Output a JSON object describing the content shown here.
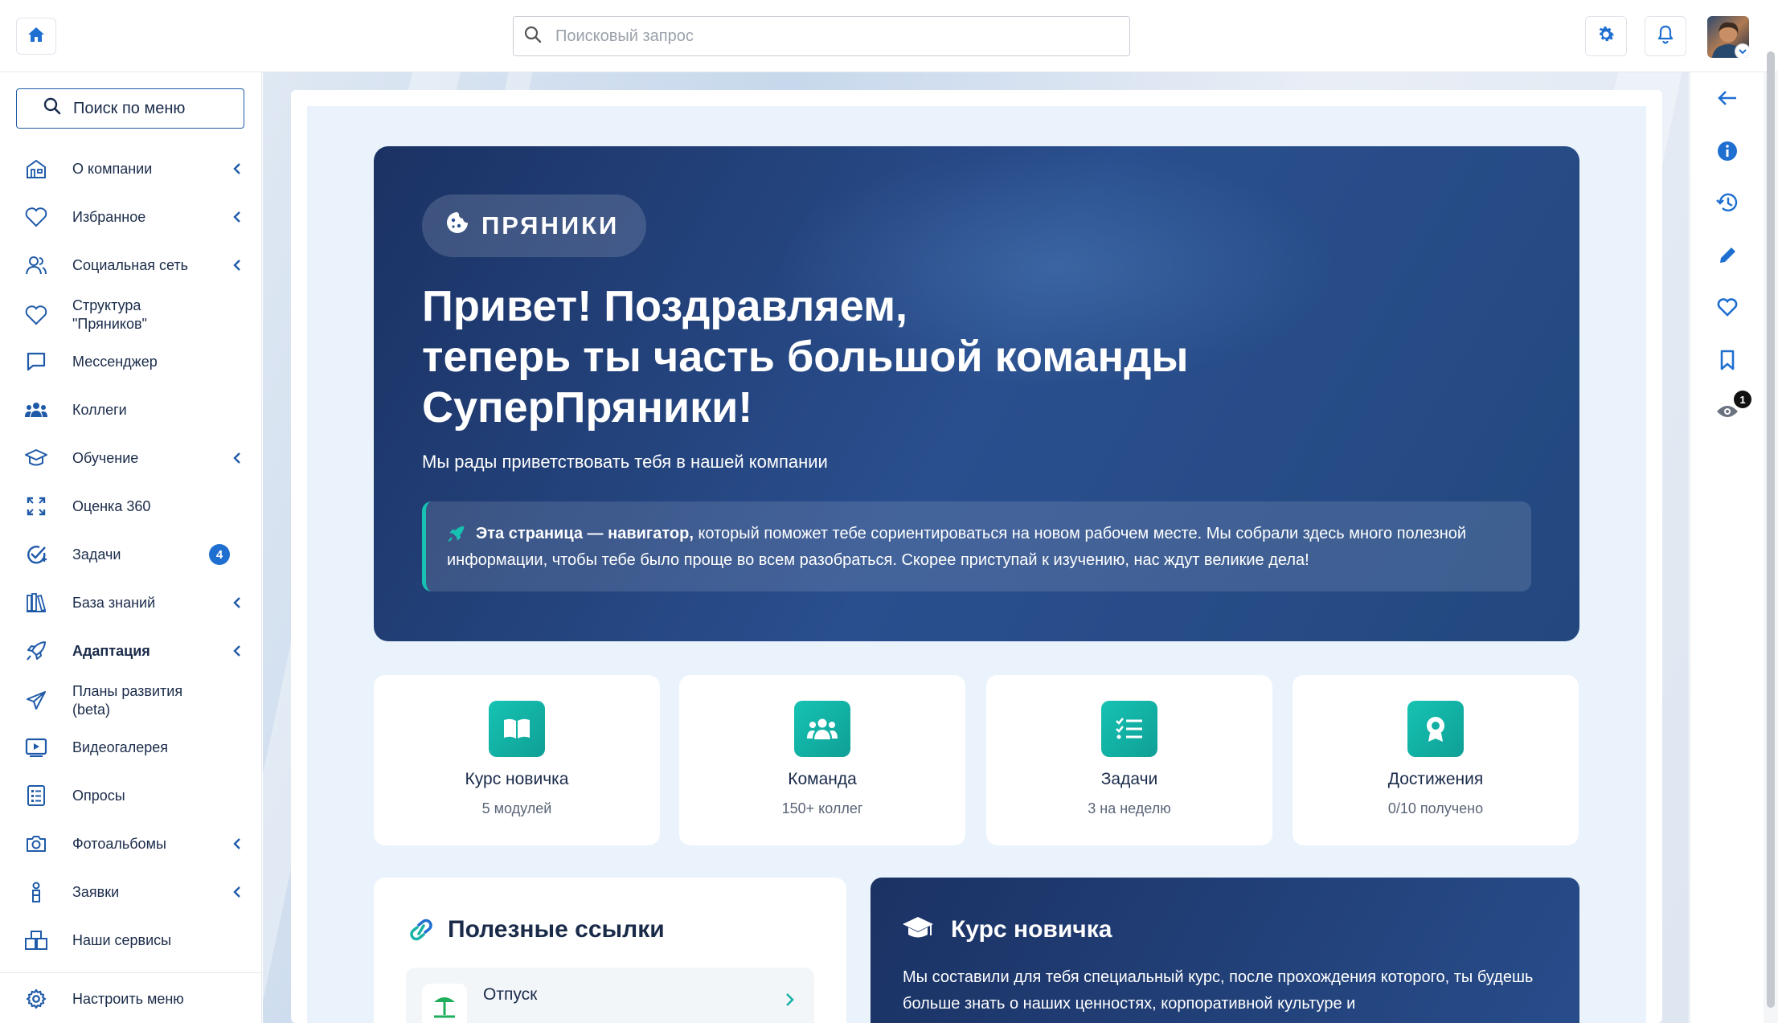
{
  "topbar": {
    "search_placeholder": "Поисковый запрос"
  },
  "sidebar": {
    "search_label": "Поиск по меню",
    "items": [
      {
        "label": "О компании",
        "icon": "building-icon",
        "has_arrow": true
      },
      {
        "label": "Избранное",
        "icon": "heart-icon",
        "has_arrow": true
      },
      {
        "label": "Социальная сеть",
        "icon": "people-icon",
        "has_arrow": true
      },
      {
        "label": "Структура \"Пряников\"",
        "icon": "heart-icon",
        "has_arrow": false
      },
      {
        "label": "Мессенджер",
        "icon": "chat-icon",
        "has_arrow": false
      },
      {
        "label": "Коллеги",
        "icon": "group-icon",
        "has_arrow": false
      },
      {
        "label": "Обучение",
        "icon": "graduation-cap-icon",
        "has_arrow": true
      },
      {
        "label": "Оценка 360",
        "icon": "expand-icon",
        "has_arrow": false
      },
      {
        "label": "Задачи",
        "icon": "task-check-icon",
        "has_arrow": false,
        "badge": "4"
      },
      {
        "label": "База знаний",
        "icon": "books-icon",
        "has_arrow": true
      },
      {
        "label": "Адаптация",
        "icon": "rocket-icon",
        "has_arrow": true,
        "active": true
      },
      {
        "label": "Планы развития (beta)",
        "icon": "paper-plane-icon",
        "has_arrow": false
      },
      {
        "label": "Видеогалерея",
        "icon": "video-icon",
        "has_arrow": false
      },
      {
        "label": "Опросы",
        "icon": "survey-icon",
        "has_arrow": false
      },
      {
        "label": "Фотоальбомы",
        "icon": "camera-icon",
        "has_arrow": true
      },
      {
        "label": "Заявки",
        "icon": "request-icon",
        "has_arrow": true
      },
      {
        "label": "Наши сервисы",
        "icon": "boxes-icon",
        "has_arrow": false
      }
    ],
    "settings_label": "Настроить меню"
  },
  "hero": {
    "pill_label": "ПРЯНИКИ",
    "title_line1": "Привет! Поздравляем,",
    "title_line2": "теперь ты часть большой команды",
    "title_line3": "СуперПряники!",
    "subtitle": "Мы рады приветствовать тебя в нашей компании",
    "note_bold": "Эта страница — навигатор,",
    "note_text": " который поможет тебе сориентироваться на новом рабочем месте. Мы собрали здесь много полезной информации, чтобы тебе было проще во всем разобраться. Скорее приступай к изучению, нас ждут великие дела!"
  },
  "stats": [
    {
      "title": "Курс новичка",
      "subtitle": "5 модулей",
      "icon": "book-icon"
    },
    {
      "title": "Команда",
      "subtitle": "150+ коллег",
      "icon": "team-icon"
    },
    {
      "title": "Задачи",
      "subtitle": "3 на неделю",
      "icon": "checklist-icon"
    },
    {
      "title": "Достижения",
      "subtitle": "0/10 получено",
      "icon": "award-icon"
    }
  ],
  "links": {
    "title": "Полезные ссылки",
    "items": [
      {
        "label": "Отпуск",
        "icon": "beach-icon"
      }
    ]
  },
  "course": {
    "title": "Курс новичка",
    "text": "Мы составили для тебя специальный курс, после прохождения которого, ты будешь больше знать о наших ценностях, корпоративной культуре и"
  },
  "rail": {
    "views_badge": "1"
  },
  "colors": {
    "primary": "#1f6fd1",
    "hero_dark": "#1b3264",
    "accent_teal": "#16c3b3",
    "text": "#1a2b4a"
  }
}
